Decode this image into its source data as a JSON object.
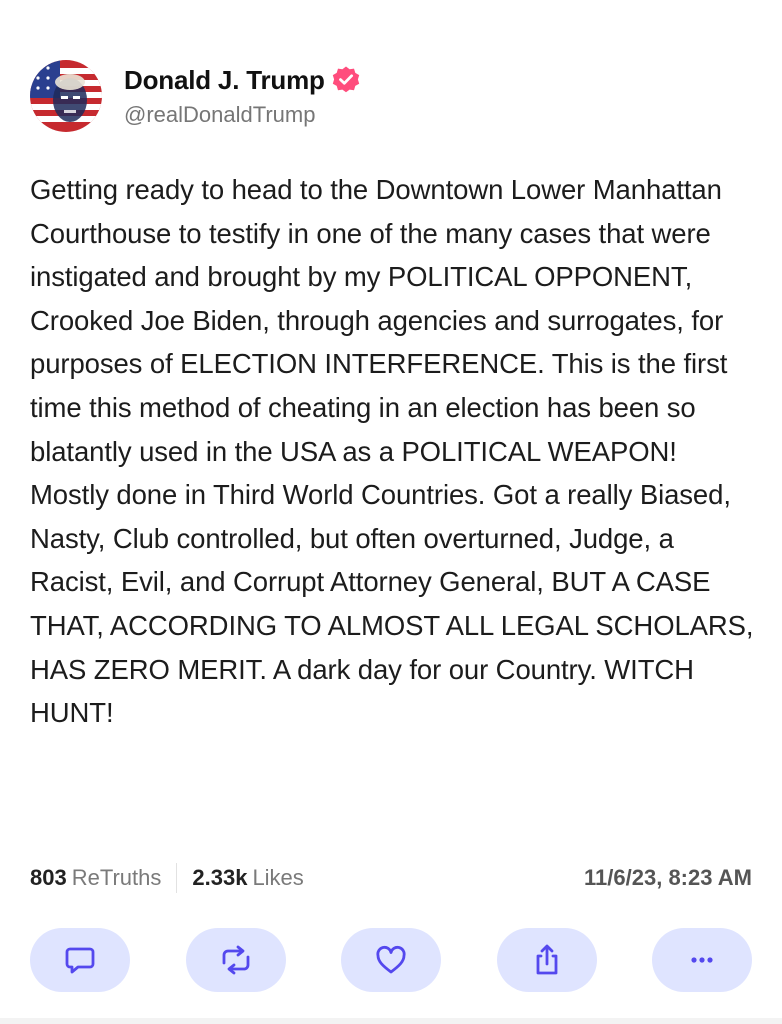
{
  "post": {
    "author": {
      "display_name": "Donald J. Trump",
      "handle": "@realDonaldTrump",
      "verified": true,
      "verified_color": "#ff4d7d"
    },
    "text": "Getting ready to head to the Downtown Lower Manhattan Courthouse to testify in one of the many cases that were instigated and brought by my POLITICAL OPPONENT, Crooked Joe Biden, through agencies and surrogates, for purposes of ELECTION INTERFERENCE. This is the first time this method of cheating in an election has been so blatantly used in the USA as a POLITICAL WEAPON! Mostly done in Third World Countries. Got a really Biased, Nasty, Club controlled, but often overturned, Judge, a Racist, Evil, and Corrupt Attorney General, BUT A CASE THAT, ACCORDING TO ALMOST ALL LEGAL SCHOLARS, HAS ZERO MERIT. A dark day for our Country. WITCH HUNT!",
    "stats": {
      "retruths_count": "803",
      "retruths_label": "ReTruths",
      "likes_count": "2.33k",
      "likes_label": "Likes"
    },
    "timestamp": "11/6/23, 8:23 AM",
    "actions": [
      {
        "icon": "reply-icon"
      },
      {
        "icon": "retruth-icon"
      },
      {
        "icon": "like-icon"
      },
      {
        "icon": "share-icon"
      },
      {
        "icon": "more-icon"
      }
    ],
    "colors": {
      "action_bg": "#dfe4ff",
      "action_icon": "#5448ee"
    }
  }
}
